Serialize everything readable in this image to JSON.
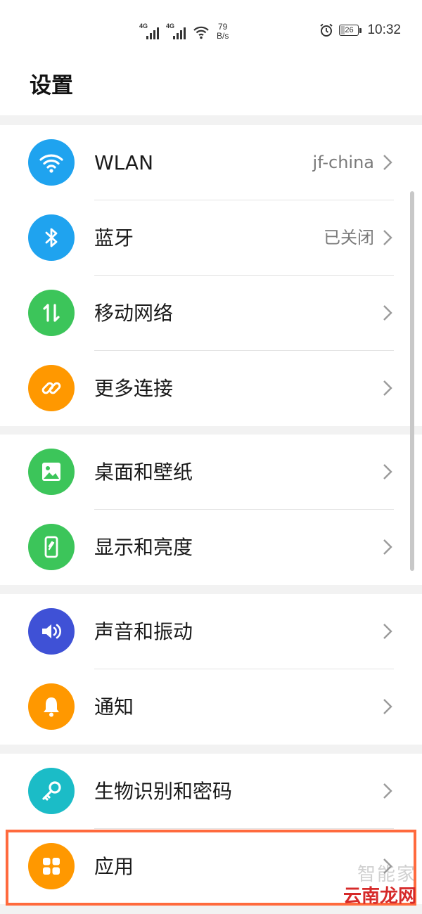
{
  "status_bar": {
    "signal1_label": "4G",
    "signal2_label": "4G",
    "speed_value": "79",
    "speed_unit": "B/s",
    "battery": "26",
    "time": "10:32"
  },
  "header": {
    "title": "设置"
  },
  "groups": [
    {
      "items": [
        {
          "label": "WLAN",
          "value": "jf-china",
          "icon": "wifi-icon",
          "color": "#1fa3ef"
        },
        {
          "label": "蓝牙",
          "value": "已关闭",
          "icon": "bluetooth-icon",
          "color": "#1fa3ef"
        },
        {
          "label": "移动网络",
          "value": "",
          "icon": "mobile-data-icon",
          "color": "#3cc55a"
        },
        {
          "label": "更多连接",
          "value": "",
          "icon": "link-icon",
          "color": "#ff9800"
        }
      ]
    },
    {
      "items": [
        {
          "label": "桌面和壁纸",
          "value": "",
          "icon": "wallpaper-icon",
          "color": "#3cc55a"
        },
        {
          "label": "显示和亮度",
          "value": "",
          "icon": "display-icon",
          "color": "#3cc55a"
        }
      ]
    },
    {
      "items": [
        {
          "label": "声音和振动",
          "value": "",
          "icon": "sound-icon",
          "color": "#3f51d6"
        },
        {
          "label": "通知",
          "value": "",
          "icon": "bell-icon",
          "color": "#ff9800"
        }
      ]
    },
    {
      "items": [
        {
          "label": "生物识别和密码",
          "value": "",
          "icon": "key-icon",
          "color": "#1bbcc7"
        },
        {
          "label": "应用",
          "value": "",
          "icon": "apps-icon",
          "color": "#ff9800"
        }
      ]
    }
  ],
  "highlight_color": "#ff6a3d",
  "watermark": {
    "top": "智能家",
    "bottom": "云南龙网"
  }
}
